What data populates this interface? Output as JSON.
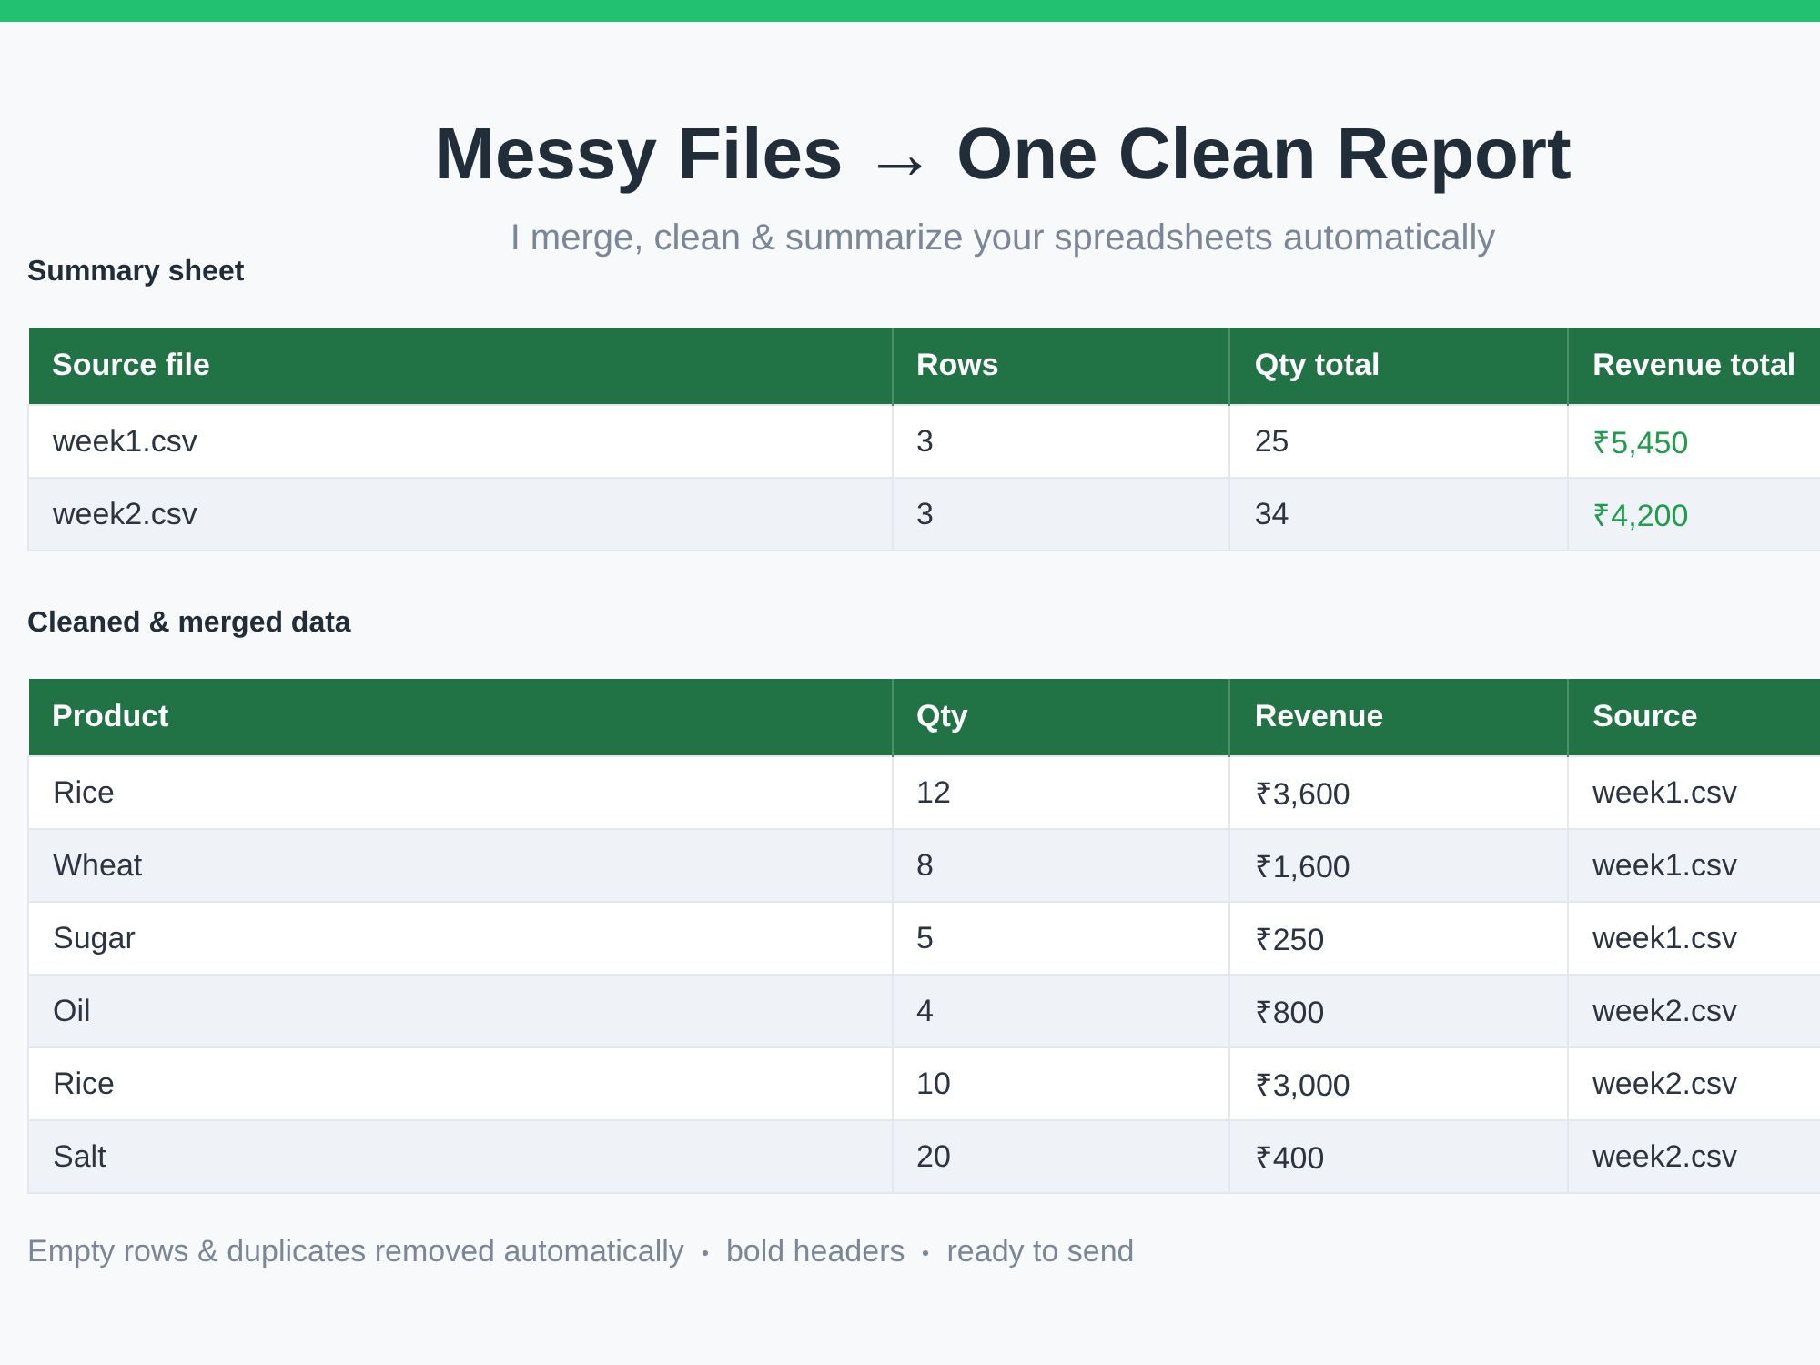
{
  "title": "Messy Files  →  One Clean Report",
  "subtitle": "I merge, clean & summarize your spreadsheets automatically",
  "tables": [
    {
      "heading": "Summary sheet",
      "columns": [
        {
          "label": "Source file",
          "highlight": false
        },
        {
          "label": "Rows",
          "highlight": false
        },
        {
          "label": "Qty total",
          "highlight": false
        },
        {
          "label": "Revenue total",
          "highlight": true
        }
      ],
      "rows": [
        [
          "week1.csv",
          "3",
          "25",
          "₹5,450"
        ],
        [
          "week2.csv",
          "3",
          "34",
          "₹4,200"
        ]
      ]
    },
    {
      "heading": "Cleaned & merged data",
      "columns": [
        {
          "label": "Product",
          "highlight": false
        },
        {
          "label": "Qty",
          "highlight": false
        },
        {
          "label": "Revenue",
          "highlight": false
        },
        {
          "label": "Source",
          "highlight": false
        }
      ],
      "rows": [
        [
          "Rice",
          "12",
          "₹3,600",
          "week1.csv"
        ],
        [
          "Wheat",
          "8",
          "₹1,600",
          "week1.csv"
        ],
        [
          "Sugar",
          "5",
          "₹250",
          "week1.csv"
        ],
        [
          "Oil",
          "4",
          "₹800",
          "week2.csv"
        ],
        [
          "Rice",
          "10",
          "₹3,000",
          "week2.csv"
        ],
        [
          "Salt",
          "20",
          "₹400",
          "week2.csv"
        ]
      ]
    }
  ],
  "footer_notes": [
    "Empty rows & duplicates removed automatically",
    "bold headers",
    "ready to send"
  ]
}
